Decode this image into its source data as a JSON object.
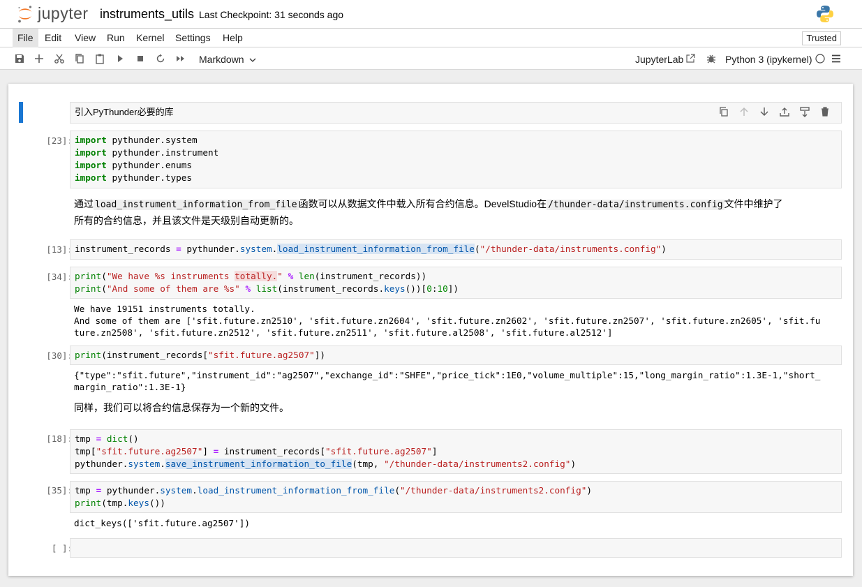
{
  "header": {
    "logo_text": "jupyter",
    "notebook_title": "instruments_utils",
    "checkpoint": "Last Checkpoint: 31 seconds ago"
  },
  "menu": {
    "items": [
      "File",
      "Edit",
      "View",
      "Run",
      "Kernel",
      "Settings",
      "Help"
    ],
    "active": "File",
    "trusted": "Trusted"
  },
  "toolbar": {
    "cell_type": "Markdown",
    "jupyterlab": "JupyterLab",
    "kernel": "Python 3 (ipykernel)",
    "icons": [
      "save-icon",
      "add-icon",
      "cut-icon",
      "copy-icon",
      "paste-icon",
      "run-icon",
      "stop-icon",
      "restart-icon",
      "run-all-icon"
    ]
  },
  "cells": {
    "md1": {
      "text": "引入PyThunder必要的库"
    },
    "c23": {
      "prompt": "[23]:",
      "lines": [
        {
          "kw": "import",
          "rest": " pythunder.system"
        },
        {
          "kw": "import",
          "rest": " pythunder.instrument"
        },
        {
          "kw": "import",
          "rest": " pythunder.enums"
        },
        {
          "kw": "import",
          "rest": " pythunder.types"
        }
      ]
    },
    "md2": {
      "t1": "通过",
      "c1": "load_instrument_information_from_file",
      "t2": "函数可以从数据文件中载入所有合约信息。DevelStudio在",
      "c2": "/thunder-data/instruments.config",
      "t3": "文件中维护了",
      "t4": "所有的合约信息，并且该文件是天级别自动更新的。"
    },
    "c13": {
      "prompt": "[13]:",
      "var": "instrument_records",
      "eq": "=",
      "mod": "pythunder",
      "sub": "system",
      "fn": "load_instrument_information_from_file",
      "arg": "\"/thunder-data/instruments.config\""
    },
    "c34": {
      "prompt": "[34]:",
      "fn": "print",
      "s1a": "\"We have %s instruments ",
      "s1b": "totally.",
      "s1c": "\"",
      "pct": "%",
      "len": "len",
      "var": "instrument_records",
      "s2": "\"And some of them are %s\"",
      "list": "list",
      "keys": "keys",
      "slice_a": "0",
      "slice_b": "10",
      "out1": "We have 19151 instruments totally.",
      "out2": "And some of them are ['sfit.future.zn2510', 'sfit.future.zn2604', 'sfit.future.zn2602', 'sfit.future.zn2507', 'sfit.future.zn2605', 'sfit.fu",
      "out3": "ture.zn2508', 'sfit.future.zn2512', 'sfit.future.zn2511', 'sfit.future.al2508', 'sfit.future.al2512']"
    },
    "c30": {
      "prompt": "[30]:",
      "fn": "print",
      "var": "instrument_records",
      "key": "\"sfit.future.ag2507\"",
      "out1": "{\"type\":\"sfit.future\",\"instrument_id\":\"ag2507\",\"exchange_id\":\"SHFE\",\"price_tick\":1E0,\"volume_multiple\":15,\"long_margin_ratio\":1.3E-1,\"short_",
      "out2": "margin_ratio\":1.3E-1}"
    },
    "md3": {
      "text": "同样，我们可以将合约信息保存为一个新的文件。"
    },
    "c18": {
      "prompt": "[18]:",
      "tmp": "tmp",
      "eq": "=",
      "dict": "dict",
      "key": "\"sfit.future.ag2507\"",
      "var": "instrument_records",
      "mod": "pythunder",
      "sub": "system",
      "fn": "save_instrument_information_to_file",
      "arg": "\"/thunder-data/instruments2.config\""
    },
    "c35": {
      "prompt": "[35]:",
      "tmp": "tmp",
      "eq": "=",
      "mod": "pythunder",
      "sub": "system",
      "fn": "load_instrument_information_from_file",
      "arg": "\"/thunder-data/instruments2.config\"",
      "print": "print",
      "keys": "keys",
      "out": "dict_keys(['sfit.future.ag2507'])"
    },
    "empty": {
      "prompt": "[ ]:"
    }
  }
}
